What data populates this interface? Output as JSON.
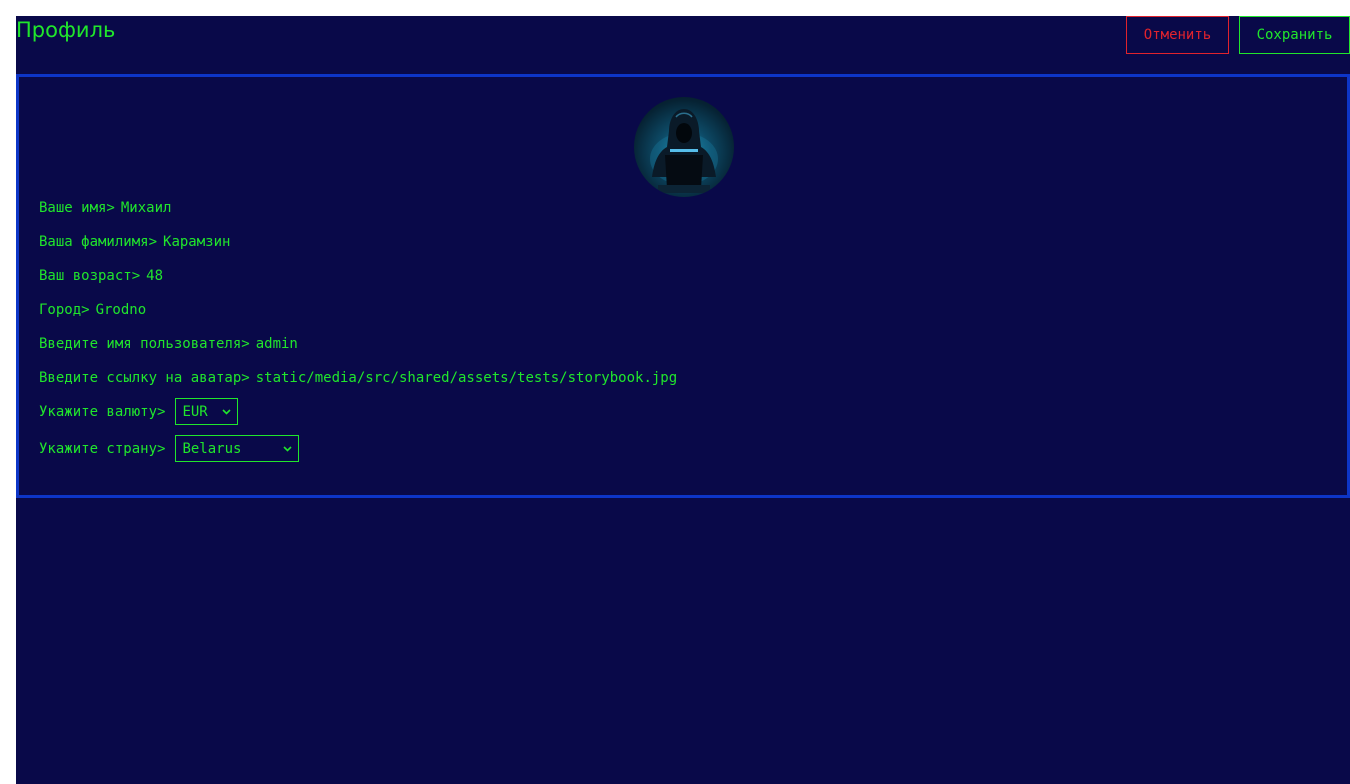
{
  "header": {
    "title": "Профиль",
    "cancel_label": "Отменить",
    "save_label": "Сохранить"
  },
  "profile": {
    "fields": [
      {
        "label": "Ваше имя>",
        "value": "Михаил"
      },
      {
        "label": "Ваша фамилимя>",
        "value": "Карамзин"
      },
      {
        "label": "Ваш возраст>",
        "value": "48"
      },
      {
        "label": "Город>",
        "value": "Grodno"
      },
      {
        "label": "Введите имя пользователя>",
        "value": "admin"
      },
      {
        "label": "Введите ссылку на аватар>",
        "value": "static/media/src/shared/assets/tests/storybook.jpg"
      }
    ],
    "currency": {
      "label": "Укажите валюту>",
      "selected": "EUR"
    },
    "country": {
      "label": "Укажите страну>",
      "selected": "Belarus"
    }
  },
  "colors": {
    "background": "#090949",
    "accent": "#20e62c",
    "danger": "#e0232d",
    "card_border": "#0d35c7"
  }
}
